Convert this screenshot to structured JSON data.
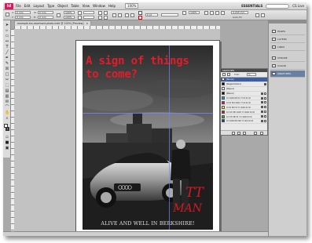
{
  "app": {
    "logo": "Id",
    "menus": [
      "File",
      "Edit",
      "Layout",
      "Type",
      "Object",
      "Table",
      "View",
      "Window",
      "Help"
    ],
    "zoom": "100%",
    "workspace": "ESSENTIALS",
    "cs_live": "CS Live"
  },
  "document_tab": {
    "title": "example-tvs-rosemont-photo.indd @ 100% [Preview]",
    "close": "×"
  },
  "poster": {
    "headline_line1": "A sign of things",
    "headline_line2": "to come?",
    "brand_line1": "TT",
    "brand_line2": "MAN",
    "tagline": "ALIVE AND WELL IN BERKSHIRE!"
  },
  "panels": [
    {
      "label": "PAGES",
      "icon": "pages-icon",
      "active": false
    },
    {
      "label": "LAYERS",
      "icon": "layers-icon",
      "active": false
    },
    {
      "label": "LINKS",
      "icon": "links-icon",
      "active": false
    },
    {
      "label": "STROKE",
      "icon": "stroke-icon",
      "active": false
    },
    {
      "label": "COLOR",
      "icon": "color-icon",
      "active": false
    },
    {
      "label": "SWATCHES",
      "icon": "swatches-icon",
      "active": true
    }
  ],
  "swatches": {
    "title": "SWATCHES",
    "tint_label": "Tint:",
    "tint_value": "%",
    "items": [
      {
        "name": "[None]",
        "color": "#ffffff",
        "selected": true
      },
      {
        "name": "[Registration]",
        "color": "#000000",
        "selected": false
      },
      {
        "name": "[Paper]",
        "color": "#ffffff",
        "selected": false
      },
      {
        "name": "[Black]",
        "color": "#000000",
        "selected": false
      },
      {
        "name": "C=100 M=0 Y=0 K=0",
        "color": "#00a0e3",
        "selected": false
      },
      {
        "name": "C=0 M=100 Y=0 K=0",
        "color": "#e5007e",
        "selected": false
      },
      {
        "name": "C=0 M=0 Y=100 K=0",
        "color": "#ffed00",
        "selected": false
      },
      {
        "name": "C=15 M=100 Y=100 K=0",
        "color": "#c9151e",
        "selected": false
      },
      {
        "name": "C=75 M=5 Y=100 K=0",
        "color": "#3aa935",
        "selected": false
      },
      {
        "name": "C=100 M=90 Y=10 K=0",
        "color": "#1d3a8a",
        "selected": false
      }
    ]
  },
  "controls": {
    "x_value": "0 mm",
    "y_value": "0 mm",
    "w_value": "0 mm",
    "h_value": "0 mm",
    "percent_1": "100%",
    "percent_2": "100%",
    "stroke_weight": "0 pt",
    "ref_value": "4.233 mm",
    "auto_fit": "Auto-Fit"
  },
  "colors": {
    "headline": "#e31c2b",
    "brand": "#d11a22",
    "selection": "#3d5fa0"
  }
}
